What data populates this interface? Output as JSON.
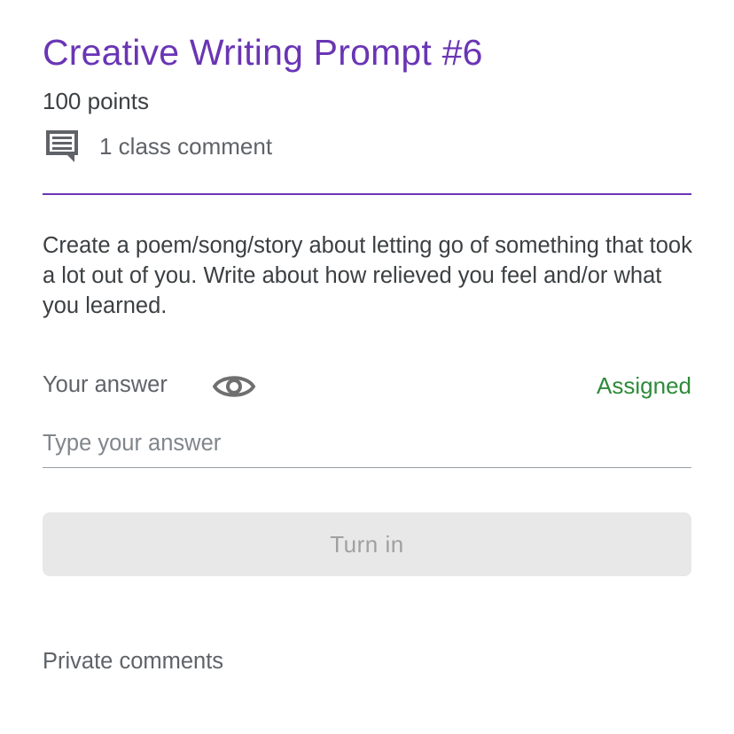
{
  "assignment": {
    "title": "Creative Writing Prompt #6",
    "points": "100 points",
    "class_comments": "1 class comment",
    "comment_icon": "comment-icon",
    "description": "Create a poem/song/story about letting go of something that took a lot out of you. Write about how relieved you feel and/or what you learned."
  },
  "answer": {
    "label": "Your answer",
    "visibility_icon": "eye-icon",
    "status": "Assigned",
    "placeholder": "Type your answer",
    "value": ""
  },
  "turn_in": {
    "label": "Turn in"
  },
  "private_comments": {
    "label": "Private comments"
  },
  "colors": {
    "accent": "#6a35b4",
    "status": "#2e8b3a",
    "button_bg": "#e8e8e8",
    "button_text": "#a0a0a0"
  }
}
